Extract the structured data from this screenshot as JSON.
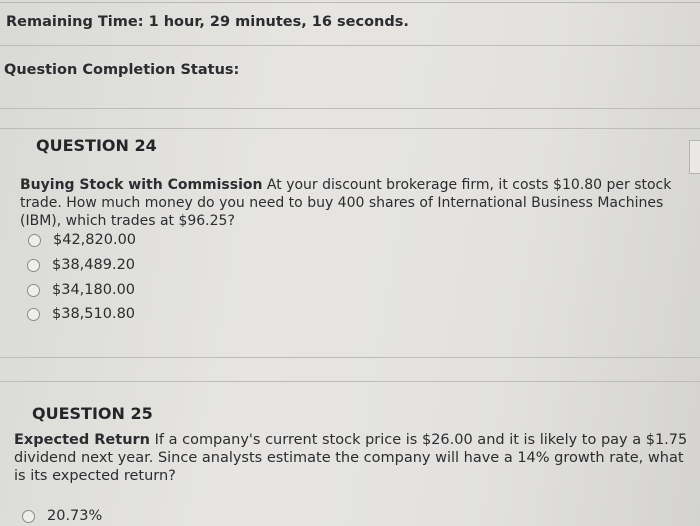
{
  "header": {
    "timer_label": "Remaining Time:",
    "timer_value": "1 hour, 29 minutes, 16 seconds.",
    "completion_label": "Question Completion Status:"
  },
  "questions": [
    {
      "title": "QUESTION 24",
      "lead": "Buying Stock with Commission",
      "body": " At your discount brokerage firm, it costs $10.80 per stock trade. How much money do you need to buy 400 shares of International Business Machines (IBM), which trades at $96.25?",
      "choices": [
        "$42,820.00",
        "$38,489.20",
        "$34,180.00",
        "$38,510.80"
      ]
    },
    {
      "title": "QUESTION 25",
      "lead": "Expected Return",
      "body": " If a company's current stock price is $26.00 and it is likely to pay a $1.75 dividend next year. Since analysts estimate the company will have a 14% growth rate, what is its expected return?",
      "choices": [
        "20.73%"
      ]
    }
  ]
}
